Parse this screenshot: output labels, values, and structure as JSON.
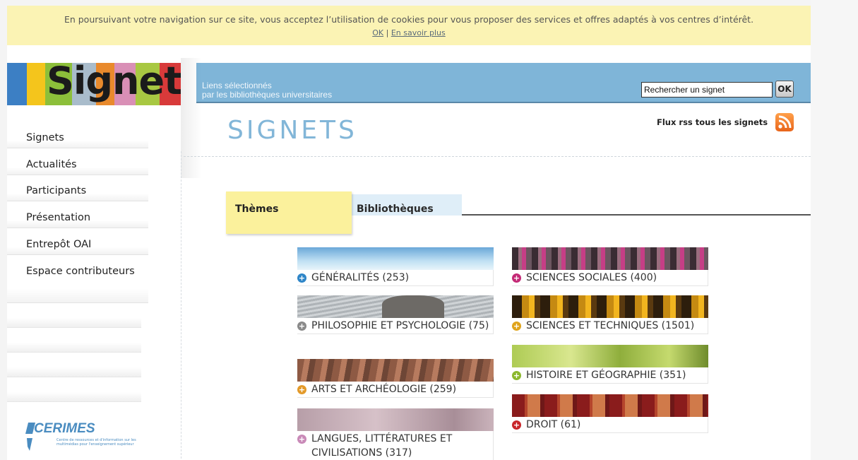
{
  "cookie_banner": {
    "text": "En poursuivant votre navigation sur ce site, vous acceptez l’utilisation de cookies pour vous proposer des services et offres adaptés à vos centres d’intérêt.",
    "ok_label": "OK",
    "separator": "|",
    "more_label": "En savoir plus"
  },
  "header": {
    "logo_text": "Signets",
    "tagline_line1": "Liens sélectionnés",
    "tagline_line2": "par les bibliothèques universitaires",
    "search_value": "Rechercher un signet",
    "search_button": "OK",
    "rss_label": "Flux rss tous les signets",
    "rss_icon": "rss-icon"
  },
  "page_title": "SIGNETS",
  "sidebar": {
    "items": [
      {
        "label": "Signets"
      },
      {
        "label": "Actualités"
      },
      {
        "label": "Participants"
      },
      {
        "label": "Présentation"
      },
      {
        "label": "Entrepôt OAI"
      },
      {
        "label": "Espace contributeurs"
      }
    ],
    "partner_logo": "CERIMES",
    "partner_tagline": "Centre de ressources et d'information sur les multimédias pour l'enseignement supérieur"
  },
  "tabs": [
    {
      "label": "Thèmes",
      "active": true
    },
    {
      "label": "Bibliothèques",
      "active": false
    }
  ],
  "categories": {
    "left": [
      {
        "label": "GÉNÉRALITÉS (253)",
        "color": "#2f86c8"
      },
      {
        "label": "PHILOSOPHIE ET PSYCHOLOGIE (75)",
        "color": "#8a8a8a"
      },
      {
        "label": "ARTS ET ARCHÉOLOGIE (259)",
        "color": "#e39a2a"
      },
      {
        "label": "LANGUES, LITTÉRATURES ET CIVILISATIONS (317)",
        "color": "#c98ab8"
      }
    ],
    "right": [
      {
        "label": "SCIENCES SOCIALES (400)",
        "color": "#c42a76"
      },
      {
        "label": "SCIENCES ET TECHNIQUES (1501)",
        "color": "#e0a41c"
      },
      {
        "label": "HISTOIRE ET GÉOGRAPHIE (351)",
        "color": "#8cb82e"
      },
      {
        "label": "DROIT (61)",
        "color": "#c8262a"
      }
    ]
  },
  "colors": {
    "banner_bg": "#fbf3b4",
    "header_band": "#7fb5d8",
    "title": "#82b6d8",
    "active_tab": "#fbf19c",
    "inactive_tab": "#dfeef8"
  }
}
